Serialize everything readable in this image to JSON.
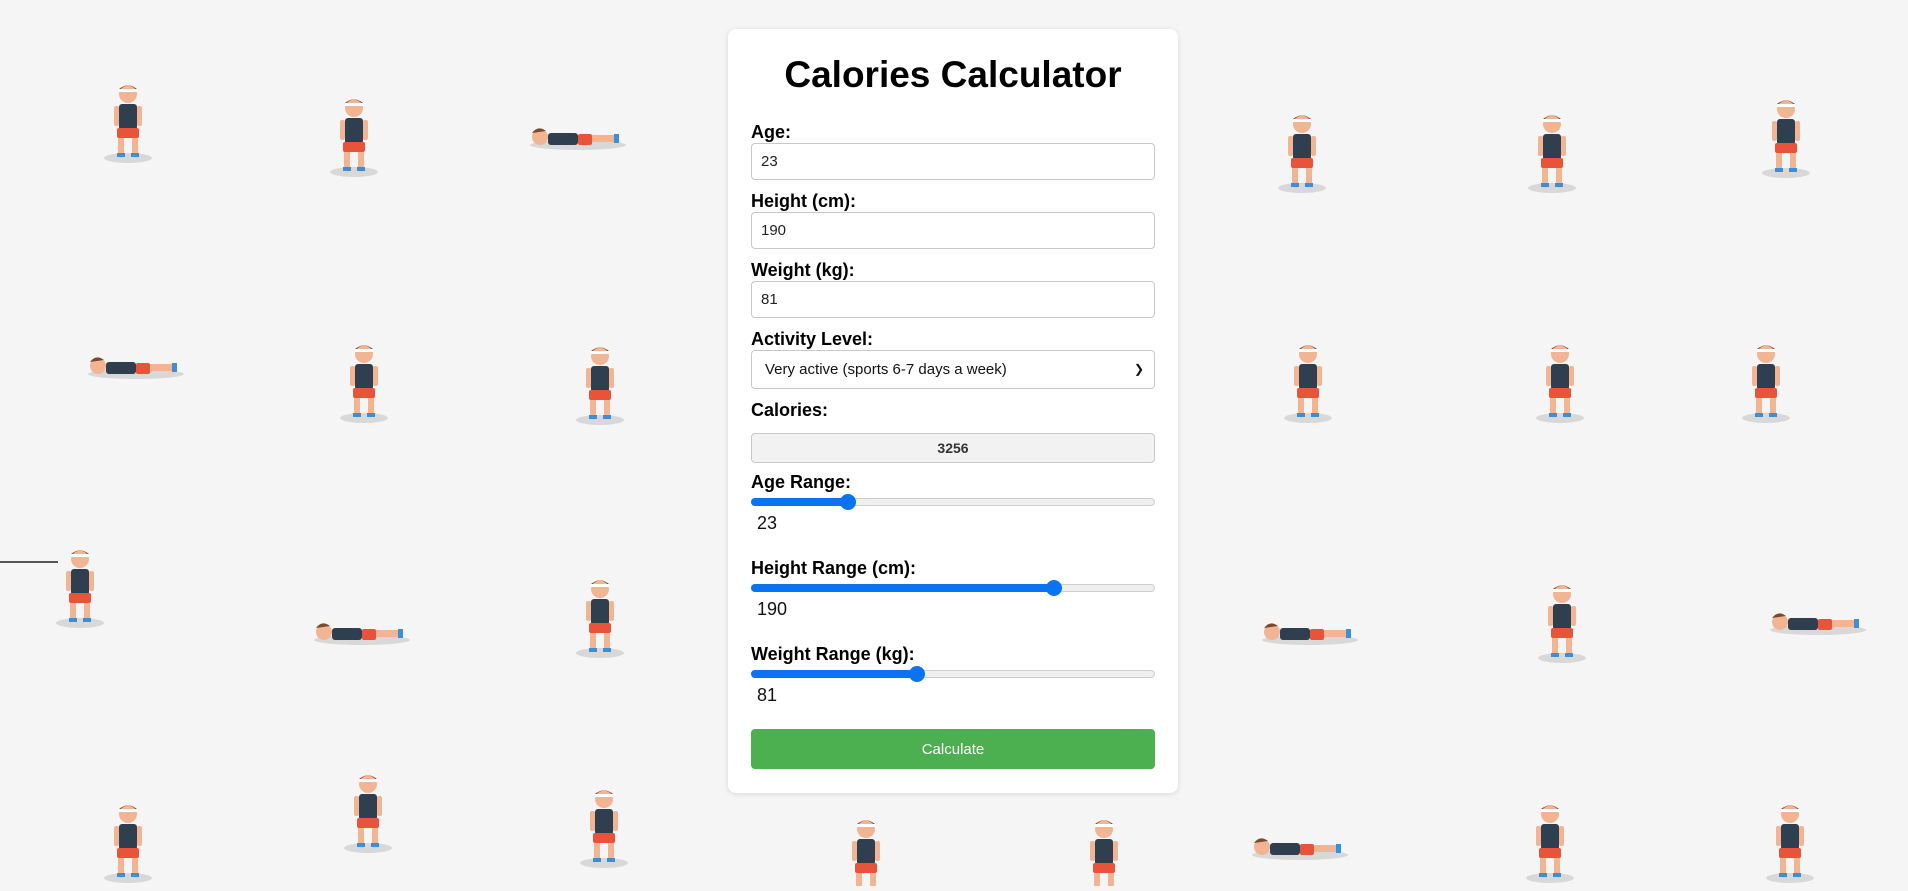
{
  "app": {
    "title": "Calories Calculator"
  },
  "form": {
    "age_label": "Age:",
    "age_value": "23",
    "height_label": "Height (cm):",
    "height_value": "190",
    "weight_label": "Weight (kg):",
    "weight_value": "81",
    "activity_label": "Activity Level:",
    "activity_selected": "Very active (sports 6-7 days a week)",
    "calories_label": "Calories:",
    "calories_value": "3256"
  },
  "ranges": {
    "age": {
      "label": "Age Range:",
      "value": "23",
      "fraction": 0.24
    },
    "height": {
      "label": "Height Range (cm):",
      "value": "190",
      "fraction": 0.75
    },
    "weight": {
      "label": "Weight Range (kg):",
      "value": "81",
      "fraction": 0.41
    }
  },
  "button": {
    "calculate_label": "Calculate"
  },
  "colors": {
    "accent_blue": "#0a74f0",
    "button_green": "#4caf50",
    "background": "#f5f5f5"
  },
  "background_icons": "exercise-figure-icon"
}
